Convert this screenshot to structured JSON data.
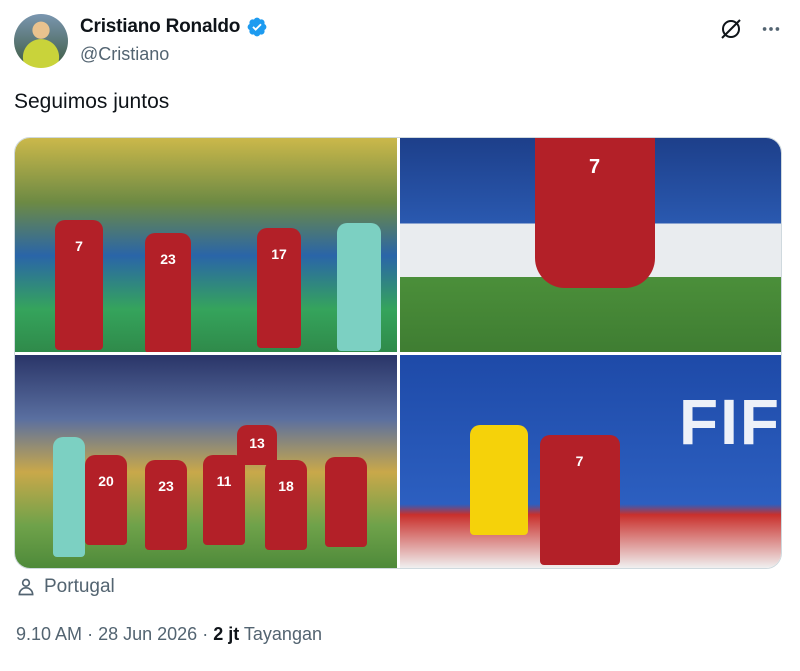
{
  "user": {
    "display_name": "Cristiano Ronaldo",
    "handle": "@Cristiano",
    "verified": true,
    "verified_color": "#1d9bf0"
  },
  "tweet": {
    "text": "Seguimos juntos"
  },
  "media": {
    "photos": [
      {
        "description_icon": "team-photo"
      },
      {
        "description_icon": "player-photo"
      },
      {
        "description_icon": "team-lineup-photo"
      },
      {
        "description_icon": "match-action-photo"
      }
    ],
    "banner_text": "FIF",
    "jersey_numbers": [
      "7",
      "23",
      "17",
      "7",
      "20",
      "23",
      "11",
      "18",
      "13",
      "7"
    ]
  },
  "location": {
    "label": "Portugal",
    "icon": "person-icon"
  },
  "meta": {
    "time": "9.10 AM",
    "sep1": "·",
    "date": "28 Jun 2026",
    "sep2": "·",
    "views_count": "2 jt",
    "views_label": "Tayangan"
  },
  "icons": {
    "grok": "grok-icon",
    "more": "more-icon"
  }
}
